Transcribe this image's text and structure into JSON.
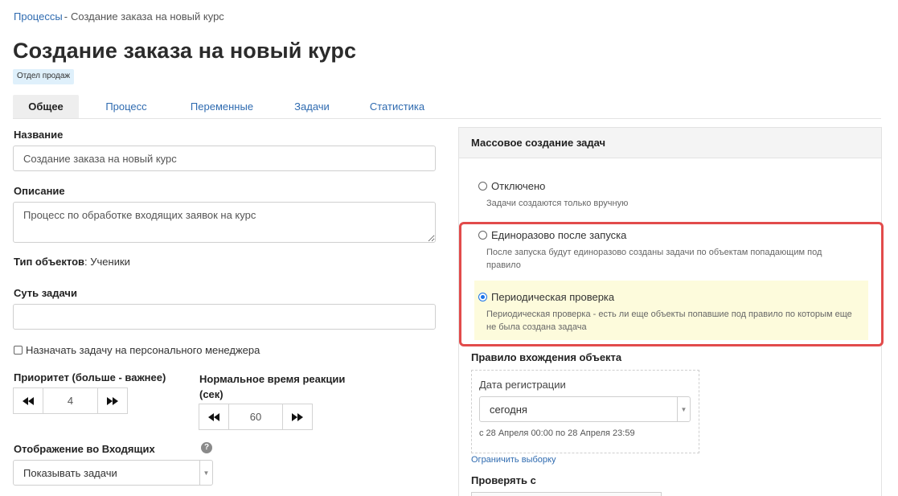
{
  "breadcrumb": {
    "parent": "Процессы",
    "separator": "-",
    "current": "Создание заказа на новый курс"
  },
  "title": "Создание заказа на новый курс",
  "badge": "Отдел продаж",
  "tabs": [
    {
      "label": "Общее",
      "active": true
    },
    {
      "label": "Процесс",
      "active": false
    },
    {
      "label": "Переменные",
      "active": false
    },
    {
      "label": "Задачи",
      "active": false
    },
    {
      "label": "Статистика",
      "active": false
    }
  ],
  "form": {
    "name_label": "Название",
    "name_value": "Создание заказа на новый курс",
    "description_label": "Описание",
    "description_value": "Процесс по обработке входящих заявок на курс",
    "object_type_label": "Тип объектов",
    "object_type_value": ": Ученики",
    "task_essence_label": "Суть задачи",
    "task_essence_value": "",
    "assign_personal_manager": "Назначать задачу на персонального менеджера",
    "priority_label": "Приоритет (больше - важнее)",
    "priority_value": "4",
    "reaction_time_label": "Нормальное время реакции (сек)",
    "reaction_time_value": "60",
    "inbox_display_label": "Отображение во Входящих",
    "inbox_display_value": "Показывать задачи"
  },
  "mass_creation": {
    "heading": "Массовое создание задач",
    "options": [
      {
        "label": "Отключено",
        "desc": "Задачи создаются только вручную",
        "checked": false
      },
      {
        "label": "Единоразово после запуска",
        "desc": "После запуска будут единоразово созданы задачи по объектам попадающим под правило",
        "checked": false
      },
      {
        "label": "Периодическая проверка",
        "desc": "Периодическая проверка - есть ли еще объекты попавшие под правило по которым еще не была создана задача",
        "checked": true
      }
    ],
    "rule_label": "Правило вхождения объекта",
    "rule_field_label": "Дата регистрации",
    "rule_select_value": "сегодня",
    "rule_range": "с 28 Апреля 00:00 по 28 Апреля 23:59",
    "limit_link": "Ограничить выборку",
    "check_from_label": "Проверять с"
  },
  "colors": {
    "accent": "#2f6bb0",
    "highlight_border": "#e24b4b",
    "highlight_bg": "#fdfbdc",
    "badge_bg": "#dff0fb"
  }
}
